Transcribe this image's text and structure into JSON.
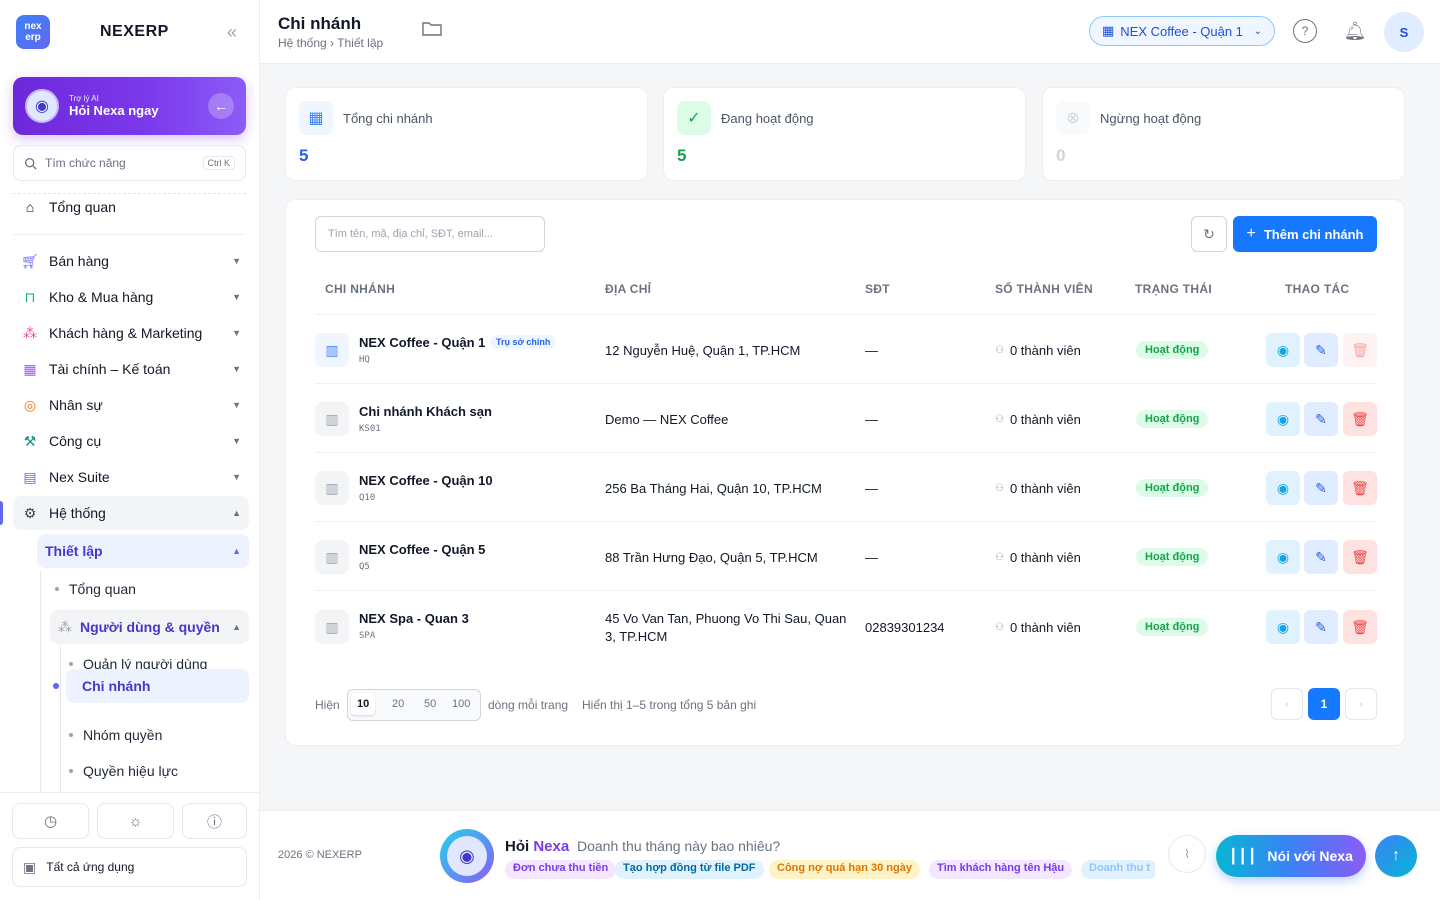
{
  "sidebar": {
    "logo_line1": "nex",
    "logo_line2": "erp",
    "brand": "NEXERP",
    "collapse_icon": "«",
    "ai": {
      "small": "Trợ lý AI",
      "big": "Hỏi Nexa ngay"
    },
    "search": {
      "placeholder": "Tìm chức năng",
      "shortcut": "Ctrl K"
    },
    "overview": "Tổng quan",
    "groups": [
      {
        "label": "Bán hàng",
        "icon": "cart-icon"
      },
      {
        "label": "Kho & Mua hàng",
        "icon": "bag-icon"
      },
      {
        "label": "Khách hàng & Marketing",
        "icon": "users-icon"
      },
      {
        "label": "Tài chính – Kế toán",
        "icon": "calculator-icon"
      },
      {
        "label": "Nhân sự",
        "icon": "person-icon"
      },
      {
        "label": "Công cụ",
        "icon": "wrench-icon"
      },
      {
        "label": "Nex Suite",
        "icon": "document-icon"
      },
      {
        "label": "Hệ thống",
        "icon": "gear-icon"
      }
    ],
    "setup": "Thiết lập",
    "sub": {
      "overview": "Tổng quan",
      "users_perms": "Người dùng & quyền",
      "user_mgmt": "Quản lý người dùng",
      "branches": "Chi nhánh",
      "roles": "Nhóm quyền",
      "effective": "Quyền hiệu lực"
    },
    "all_apps": "Tất cả ứng dụng"
  },
  "header": {
    "title": "Chi nhánh",
    "breadcrumb": "Hệ thống › Thiết lập",
    "branch_selector": "NEX Coffee - Quận 1",
    "avatar": "S"
  },
  "stats": [
    {
      "label": "Tổng chi nhánh",
      "value": "5",
      "color": "#2563eb"
    },
    {
      "label": "Đang hoạt động",
      "value": "5",
      "color": "#16a34a"
    },
    {
      "label": "Ngừng hoạt động",
      "value": "0",
      "color": "#d1d5db"
    }
  ],
  "table": {
    "search_placeholder": "Tìm tên, mã, địa chỉ, SĐT, email...",
    "add_label": "Thêm chi nhánh",
    "headers": [
      "CHI NHÁNH",
      "ĐỊA CHỈ",
      "SĐT",
      "SỐ THÀNH VIÊN",
      "TRẠNG THÁI",
      "THAO TÁC"
    ],
    "rows": [
      {
        "name": "NEX Coffee - Quận 1",
        "code": "HQ",
        "badge": "Trụ sở chính",
        "address": "12 Nguyễn Huệ, Quận 1, TP.HCM",
        "phone": "—",
        "members": "0 thành viên",
        "status": "Hoạt động"
      },
      {
        "name": "Chi nhánh Khách sạn",
        "code": "KS01",
        "address": "Demo — NEX Coffee",
        "phone": "—",
        "members": "0 thành viên",
        "status": "Hoạt động"
      },
      {
        "name": "NEX Coffee - Quận 10",
        "code": "Q10",
        "address": "256 Ba Tháng Hai, Quận 10, TP.HCM",
        "phone": "—",
        "members": "0 thành viên",
        "status": "Hoạt động"
      },
      {
        "name": "NEX Coffee - Quận 5",
        "code": "Q5",
        "address": "88 Trần Hưng Đạo, Quận 5, TP.HCM",
        "phone": "—",
        "members": "0 thành viên",
        "status": "Hoạt động"
      },
      {
        "name": "NEX Spa - Quan 3",
        "code": "SPA",
        "address_line1": "45 Vo Van Tan, Phuong Vo Thi Sau, Quan",
        "address_line2": "3, TP.HCM",
        "phone": "02839301234",
        "members": "0 thành viên",
        "status": "Hoạt động"
      }
    ],
    "pager": {
      "show_label": "Hiện",
      "sizes": [
        "10",
        "20",
        "50",
        "100"
      ],
      "per_page_label": "dòng mỗi trang",
      "summary": "Hiển thị 1–5 trong tổng 5 bản ghi",
      "current_page": "1"
    }
  },
  "footer": {
    "copyright": "2026 © NEXERP",
    "ask_prefix": "Hỏi",
    "ask_name": "Nexa",
    "question": "Doanh thu tháng này bao nhiêu?",
    "chips": [
      "Đơn chưa thu tiền",
      "Tạo hợp đồng từ file PDF",
      "Công nợ quá hạn 30 ngày",
      "Tìm khách hàng tên Hậu",
      "Doanh thu t"
    ],
    "talk_label": "Nói với Nexa"
  }
}
